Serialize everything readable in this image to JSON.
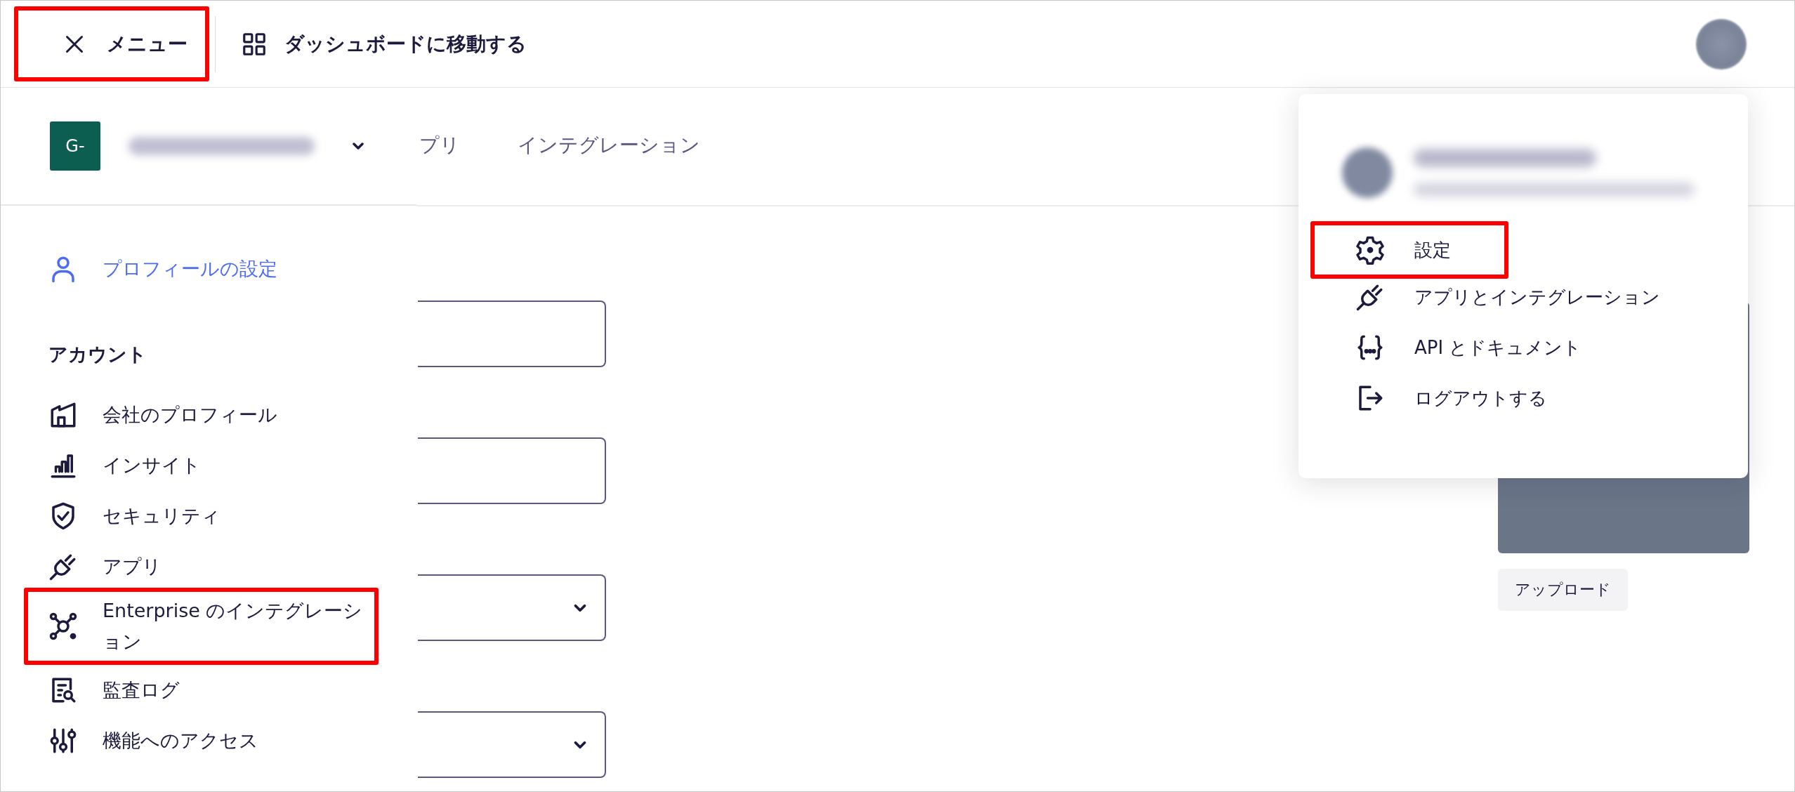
{
  "top_bar": {
    "menu_button": {
      "label": "メニュー",
      "highlighted": true
    },
    "dashboard_link": "ダッシュボードに移動する"
  },
  "tabs": [
    {
      "label": "プリ",
      "selected": false
    },
    {
      "label": "インテグレーション",
      "selected": false
    }
  ],
  "form": {
    "fields": [
      {
        "kind": "text"
      },
      {
        "kind": "text"
      },
      {
        "kind": "select"
      },
      {
        "kind": "select"
      }
    ],
    "upload_button": "アップロード"
  },
  "sidebar": {
    "org_badge": "G-",
    "profile_link": "プロフィールの設定",
    "section_title": "アカウント",
    "items": [
      {
        "label": "会社のプロフィール",
        "highlighted": false
      },
      {
        "label": "インサイト",
        "highlighted": false
      },
      {
        "label": "セキュリティ",
        "highlighted": false
      },
      {
        "label": "アプリ",
        "highlighted": false
      },
      {
        "label": "Enterprise のインテグレーション",
        "highlighted": true
      },
      {
        "label": "監査ログ",
        "highlighted": false
      },
      {
        "label": "機能へのアクセス",
        "highlighted": false
      }
    ]
  },
  "profile_menu": {
    "items": [
      {
        "label": "設定",
        "highlighted": true
      },
      {
        "label": "アプリとインテグレーション",
        "highlighted": false
      },
      {
        "label": "API とドキュメント",
        "highlighted": false
      },
      {
        "label": "ログアウトする",
        "highlighted": false
      }
    ]
  }
}
